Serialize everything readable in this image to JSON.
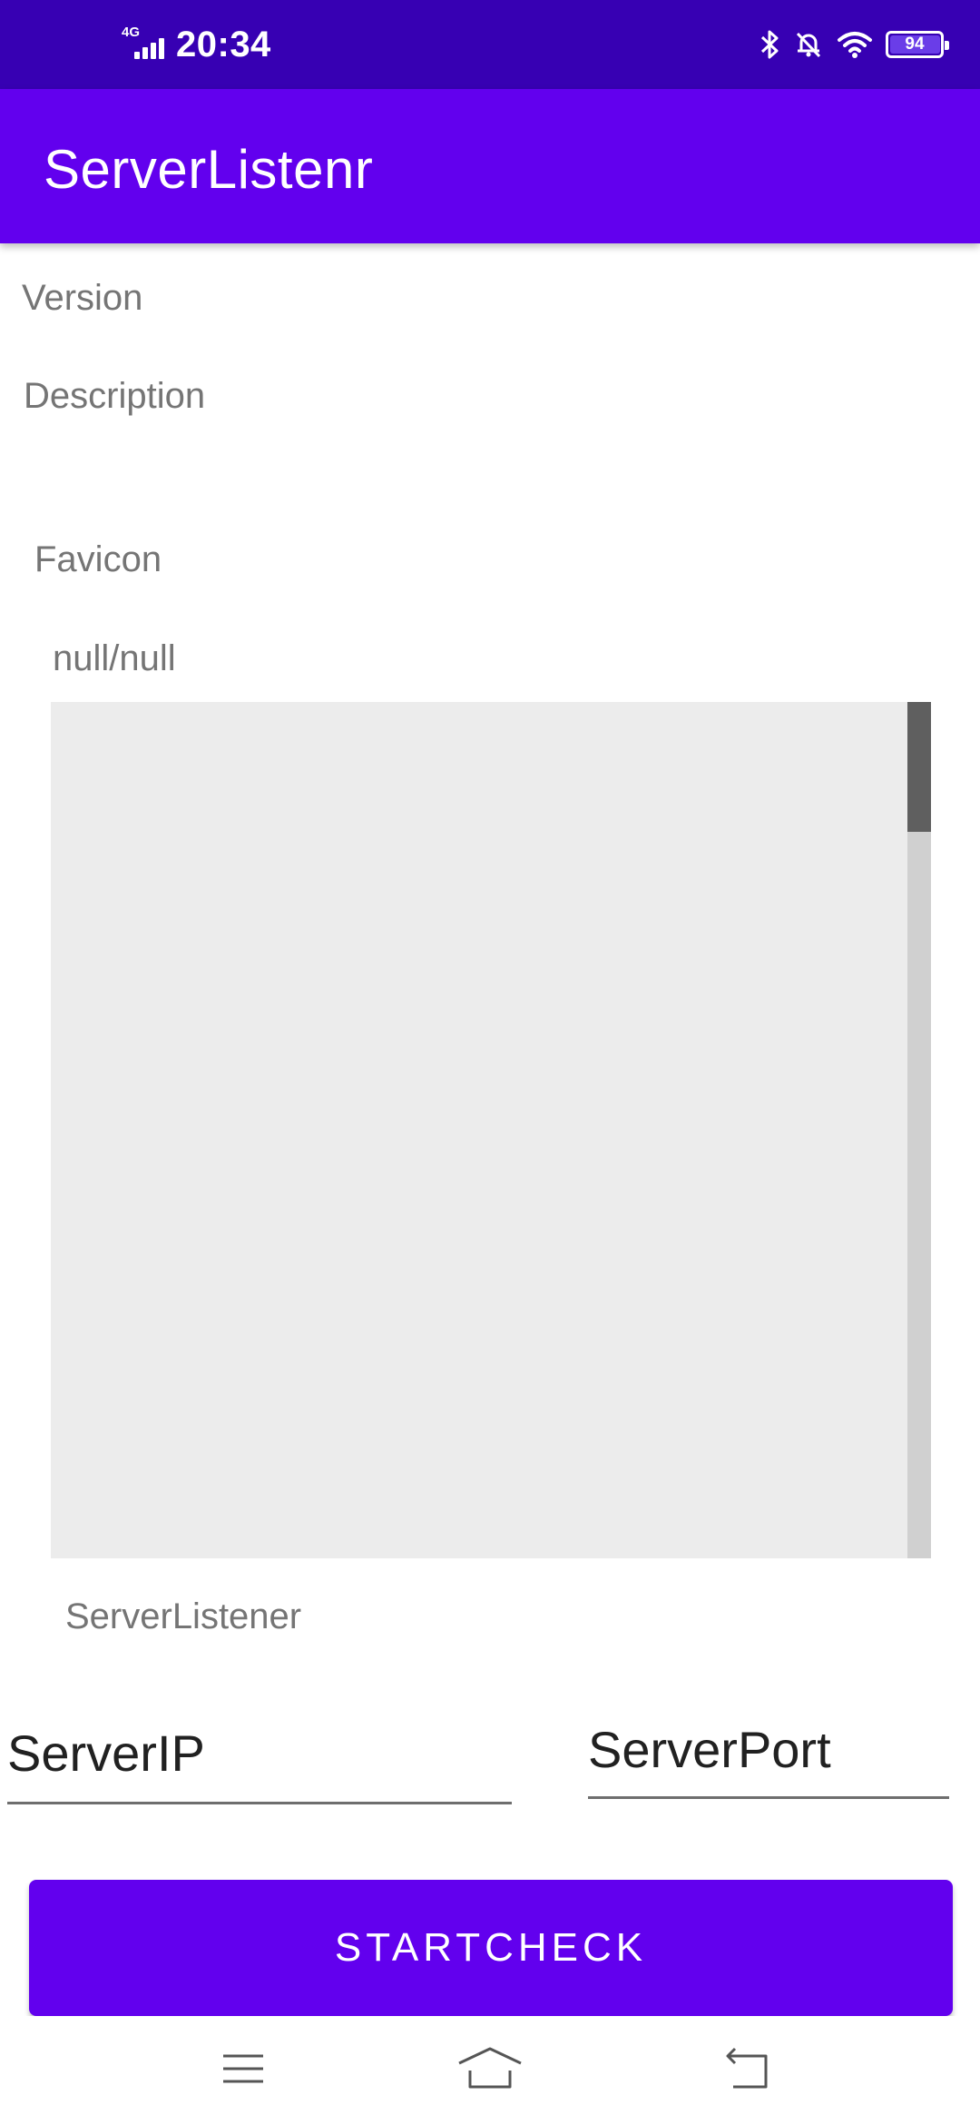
{
  "status_bar": {
    "time": "20:34",
    "network": "4G",
    "battery_level": "94",
    "icons": [
      "bluetooth-icon",
      "bell-off-icon",
      "wifi-icon",
      "battery-icon"
    ]
  },
  "app_bar": {
    "title": "ServerListenr"
  },
  "content": {
    "version_label": "Version",
    "description_label": "Description",
    "favicon_label": "Favicon",
    "players_text": "null/null",
    "footer_label": "ServerListener"
  },
  "form": {
    "server_ip": "ServerIP",
    "server_port": "ServerPort"
  },
  "actions": {
    "start_check": "STARTCHECK"
  },
  "nav_bar": {
    "icons": [
      "menu-icon",
      "home-icon",
      "back-icon"
    ]
  },
  "colors": {
    "status_bar": "#3700b3",
    "primary": "#6200ee",
    "favicon_bg": "#ececec",
    "label_gray": "#757575"
  }
}
